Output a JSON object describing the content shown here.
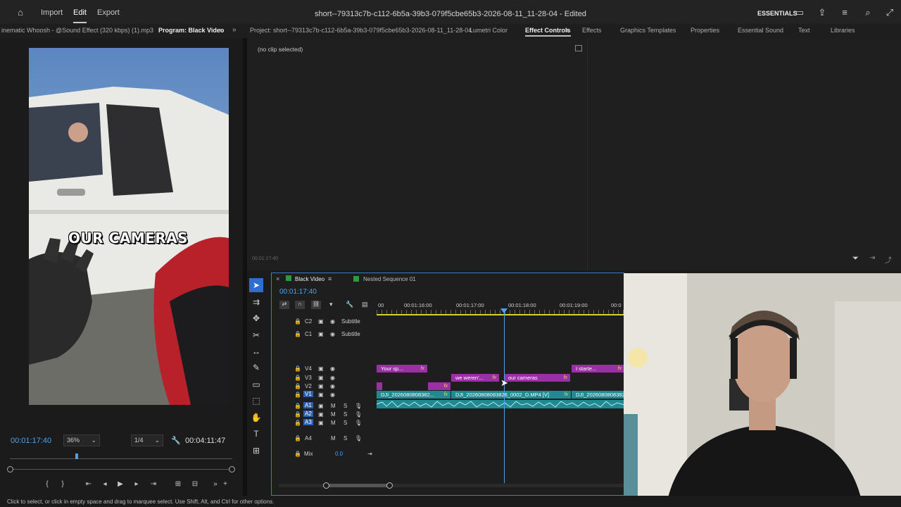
{
  "topbar": {
    "nav": [
      "Import",
      "Edit",
      "Export"
    ],
    "active_nav": "Edit",
    "title": "short--79313c7b-c112-6b5a-39b3-079f5cbe65b3-2026-08-11_11-28-04 - Edited",
    "workspace": "ESSENTIALS",
    "icons": [
      "home-icon",
      "workspace-panel-icon",
      "share-icon",
      "menu-icon",
      "quick-actions-icon",
      "fullscreen-icon"
    ]
  },
  "panel_tabs": {
    "left": [
      {
        "label": "inematic Whoosh - @Sound Effect (320 kbps) (1).mp3"
      },
      {
        "label": "Program: Black Video"
      }
    ],
    "right": [
      {
        "label": "Project: short--79313c7b-c112-6b5a-39b3-079f5cbe65b3-2026-08-11_11-28-04"
      },
      {
        "label": "Lumetri Color"
      },
      {
        "label": "Effect Controls"
      },
      {
        "label": "Effects"
      },
      {
        "label": "Graphics Templates"
      },
      {
        "label": "Properties"
      },
      {
        "label": "Essential Sound"
      },
      {
        "label": "Text"
      },
      {
        "label": "Libraries"
      }
    ],
    "active_right": "Effect Controls"
  },
  "program_monitor": {
    "caption": "OUR CAMERAS",
    "current_time": "00:01:17:40",
    "zoom": "36%",
    "resolution": "1/4",
    "duration": "00:04:11:47",
    "playhead_fraction": 0.31
  },
  "effect_controls": {
    "no_clip": "(no clip selected)",
    "timecode": "00:01:17:40"
  },
  "timeline": {
    "tabs": [
      {
        "label": "Black Video"
      },
      {
        "label": "Nested Sequence 01"
      }
    ],
    "timecode": "00:01:17:40",
    "ruler": [
      "00",
      "00:01:16:00",
      "00:01:17:00",
      "00:01:18:00",
      "00:01:19:00",
      "00:0"
    ],
    "tracks": {
      "caption": [
        {
          "id": "C2",
          "name": "Subtitle"
        },
        {
          "id": "C1",
          "name": "Subtitle"
        }
      ],
      "video": [
        "V4",
        "V3",
        "V2",
        "V1"
      ],
      "audio": [
        "A1",
        "A2",
        "A3",
        "A4"
      ],
      "mix_label": "Mix",
      "mix_value": "0.0"
    },
    "clips": {
      "v4_a": "Your sp...",
      "v4_b": "I starte...",
      "v3_a": "we weren'...",
      "v3_b": "our cameras",
      "v1_a": "DJI_2026080808382...",
      "v1_b": "DJI_20260808083826_0002_D.MP4 [V]",
      "v1_c": "DJI_20260808083826..."
    },
    "fx_label": "fx"
  },
  "status_bar": "Click to select, or click in empty space and drag to marquee select. Use Shift, Alt, and Ctrl for other options.",
  "colors": {
    "accent_blue": "#4aa3f0",
    "clip_purple": "#9b2fa6",
    "clip_teal": "#1f8a91",
    "playhead": "#4aa3f0"
  }
}
